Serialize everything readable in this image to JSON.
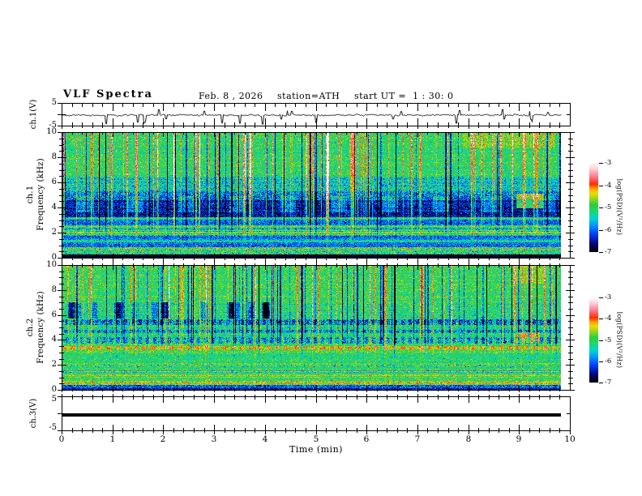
{
  "header": {
    "title": "VLF Spectra",
    "date": "Feb. 8 , 2026",
    "station": "station=ATH",
    "start_ut": "start UT =  1 : 30: 0"
  },
  "axes": {
    "time": {
      "label": "Time (min)",
      "ticks": [
        "0",
        "1",
        "2",
        "3",
        "4",
        "5",
        "6",
        "7",
        "8",
        "9",
        "10"
      ]
    },
    "freq": {
      "label": "Frequency (kHz)",
      "ticks": [
        "10",
        "8",
        "6",
        "4",
        "2",
        "0"
      ]
    },
    "volts": {
      "ticks": [
        "5",
        "-5"
      ]
    }
  },
  "panels": {
    "ch1_wave": {
      "label": "ch.1(V)"
    },
    "ch1_spec": {
      "label": "ch.1"
    },
    "ch2_spec": {
      "label": "ch.2"
    },
    "ch3_wave": {
      "label": "ch.3(V)"
    }
  },
  "colorbar": {
    "label": "log(PSD)(V²/Hz)",
    "ticks": [
      "-3",
      "-4",
      "-5",
      "-6",
      "-7"
    ]
  },
  "chart_data": {
    "type": "heatmap",
    "title": "VLF Spectra",
    "xlabel": "Time (min)",
    "xlim": [
      0,
      10
    ],
    "data_end_min": 9.82,
    "zlim": [
      -7,
      -3
    ],
    "z_unit": "log(PSD)(V²/Hz)",
    "seed": 20260208,
    "colormap": [
      [
        0,
        0,
        0,
        0
      ],
      [
        0.1,
        8,
        8,
        125
      ],
      [
        0.2,
        0,
        60,
        255
      ],
      [
        0.3,
        0,
        150,
        255
      ],
      [
        0.38,
        0,
        215,
        205
      ],
      [
        0.46,
        30,
        215,
        110
      ],
      [
        0.53,
        45,
        205,
        60
      ],
      [
        0.6,
        150,
        215,
        35
      ],
      [
        0.66,
        235,
        220,
        0
      ],
      [
        0.71,
        255,
        165,
        0
      ],
      [
        0.76,
        255,
        45,
        0
      ],
      [
        0.84,
        255,
        115,
        135
      ],
      [
        0.93,
        255,
        205,
        215
      ],
      [
        1,
        255,
        255,
        255
      ]
    ],
    "ch1_wave": {
      "type": "line",
      "ylim": [
        -5,
        5
      ],
      "baseline": -0.2,
      "noise_sigma": 0.3,
      "spikes": {
        "count": 24,
        "down_frac": 0.62,
        "down_amp": [
          1.2,
          4.3
        ],
        "up_amp": [
          0.8,
          2.6
        ]
      }
    },
    "ch1_spec": {
      "type": "spectrogram",
      "flim": [
        0,
        10
      ],
      "bands": [
        [
          9.3,
          10.01,
          -4.95,
          0.35
        ],
        [
          6.5,
          9.3,
          -5.05,
          0.3
        ],
        [
          5.3,
          6.5,
          -5.45,
          0.4
        ],
        [
          4.6,
          5.3,
          -5.95,
          0.45
        ],
        [
          3.25,
          4.6,
          -6.45,
          0.35
        ],
        [
          3.05,
          3.25,
          -5.35,
          0.3
        ],
        [
          2.6,
          3.05,
          -6.05,
          0.35
        ],
        [
          2.45,
          2.6,
          -5.05,
          0.35
        ],
        [
          2.3,
          2.45,
          -5.6,
          0.4
        ],
        [
          1.75,
          2.3,
          -5.5,
          0.45
        ],
        [
          1.45,
          1.75,
          -5.9,
          0.35
        ],
        [
          1.25,
          1.45,
          -5.35,
          0.35
        ],
        [
          0.85,
          1.25,
          -5.95,
          0.35
        ],
        [
          0.6,
          0.85,
          -4.95,
          0.55
        ],
        [
          0.3,
          0.6,
          -5.25,
          0.5
        ],
        [
          0,
          0.3,
          -6.97,
          0.05
        ]
      ],
      "hlines": [
        [
          2.2,
          0.05,
          -4.7,
          0.25
        ],
        [
          2.02,
          0.05,
          -4.65,
          0.25
        ],
        [
          1.85,
          0.04,
          -4.85,
          0.25
        ],
        [
          2.52,
          0.05,
          -4.85,
          0.3
        ],
        [
          1.35,
          0.04,
          -5.15,
          0.3
        ],
        [
          3.15,
          0.04,
          -5.2,
          0.25
        ]
      ],
      "stripes": {
        "count": 160,
        "neg_fraction": 0.35,
        "neg_amp": [
          0.7,
          1.8
        ],
        "pos_amp": [
          0.5,
          1.4
        ],
        "min_f": 0.3,
        "fade_f": 2.0
      },
      "patches": [
        [
          8.95,
          9.45,
          4.0,
          5.1,
          1.35
        ],
        [
          7.9,
          9.7,
          8.8,
          10,
          0.3
        ],
        [
          0.3,
          0.6,
          3.7,
          4.9,
          0.55
        ],
        [
          1.3,
          1.6,
          3.7,
          4.9,
          0.55
        ],
        [
          2.3,
          2.6,
          3.7,
          4.9,
          0.55
        ],
        [
          3.3,
          3.6,
          3.7,
          4.9,
          0.55
        ],
        [
          4.3,
          4.6,
          3.7,
          4.9,
          0.55
        ],
        [
          5.3,
          5.6,
          3.7,
          4.9,
          0.55
        ],
        [
          6.3,
          6.6,
          3.7,
          4.9,
          0.55
        ],
        [
          7.3,
          7.6,
          3.7,
          4.9,
          0.55
        ],
        [
          8.3,
          8.6,
          3.7,
          4.9,
          0.5
        ],
        [
          9.5,
          9.7,
          3.7,
          4.9,
          0.4
        ]
      ]
    },
    "ch2_spec": {
      "type": "spectrogram",
      "flim": [
        0,
        10
      ],
      "bands": [
        [
          7.0,
          10.01,
          -5.0,
          0.3
        ],
        [
          5.65,
          7.0,
          -5.15,
          0.35
        ],
        [
          5.25,
          5.65,
          -5.9,
          0.5,
          9,
          0.3
        ],
        [
          4.85,
          5.25,
          -5.2,
          0.35
        ],
        [
          4.55,
          4.85,
          -5.65,
          0.45,
          8,
          0.25
        ],
        [
          4.25,
          4.55,
          -5.1,
          0.3
        ],
        [
          3.75,
          4.25,
          -5.55,
          0.45,
          9,
          0.35
        ],
        [
          3.55,
          3.75,
          -4.9,
          0.3
        ],
        [
          3.25,
          3.55,
          -4.3,
          0.3,
          11,
          0.3
        ],
        [
          3.0,
          3.25,
          -4.85,
          0.3
        ],
        [
          2.2,
          3.0,
          -5.1,
          0.3
        ],
        [
          1.85,
          2.2,
          -5.35,
          0.45
        ],
        [
          1.6,
          1.85,
          -5.05,
          0.3
        ],
        [
          1.42,
          1.6,
          -5.55,
          0.3
        ],
        [
          1.0,
          1.42,
          -5.05,
          0.35
        ],
        [
          0.75,
          1.0,
          -5.1,
          0.3
        ],
        [
          0.45,
          0.75,
          -4.6,
          0.45
        ],
        [
          0.15,
          0.45,
          -6.1,
          0.4
        ],
        [
          0,
          0.15,
          -6.6,
          0.3
        ]
      ],
      "hlines": [
        [
          2.1,
          0.05,
          -4.75,
          0.3
        ],
        [
          1.95,
          0.05,
          -4.7,
          0.3
        ],
        [
          1.5,
          0.05,
          -4.4,
          0.3
        ],
        [
          1.2,
          0.05,
          -4.6,
          0.3
        ],
        [
          1.05,
          0.04,
          -4.7,
          0.3
        ],
        [
          0.6,
          0.07,
          -4.35,
          0.4
        ]
      ],
      "stripes": {
        "count": 150,
        "neg_fraction": 0.55,
        "neg_amp": [
          0.7,
          1.7
        ],
        "pos_amp": [
          0.5,
          1.1
        ],
        "min_f": 0.2,
        "fade_f": 3.2
      },
      "patches": [
        [
          8.95,
          9.4,
          3.8,
          4.6,
          0.9
        ],
        [
          8.9,
          9.5,
          8.6,
          10,
          0.35
        ]
      ],
      "random_patches": {
        "count": 18,
        "t": [
          0,
          4.2
        ],
        "f": [
          5.8,
          7.0
        ],
        "delta": -0.8,
        "width": 0.12
      }
    },
    "ch3_wave": {
      "type": "line",
      "ylim": [
        -5,
        5
      ],
      "value": -0.25,
      "thickness_px": 4
    }
  }
}
